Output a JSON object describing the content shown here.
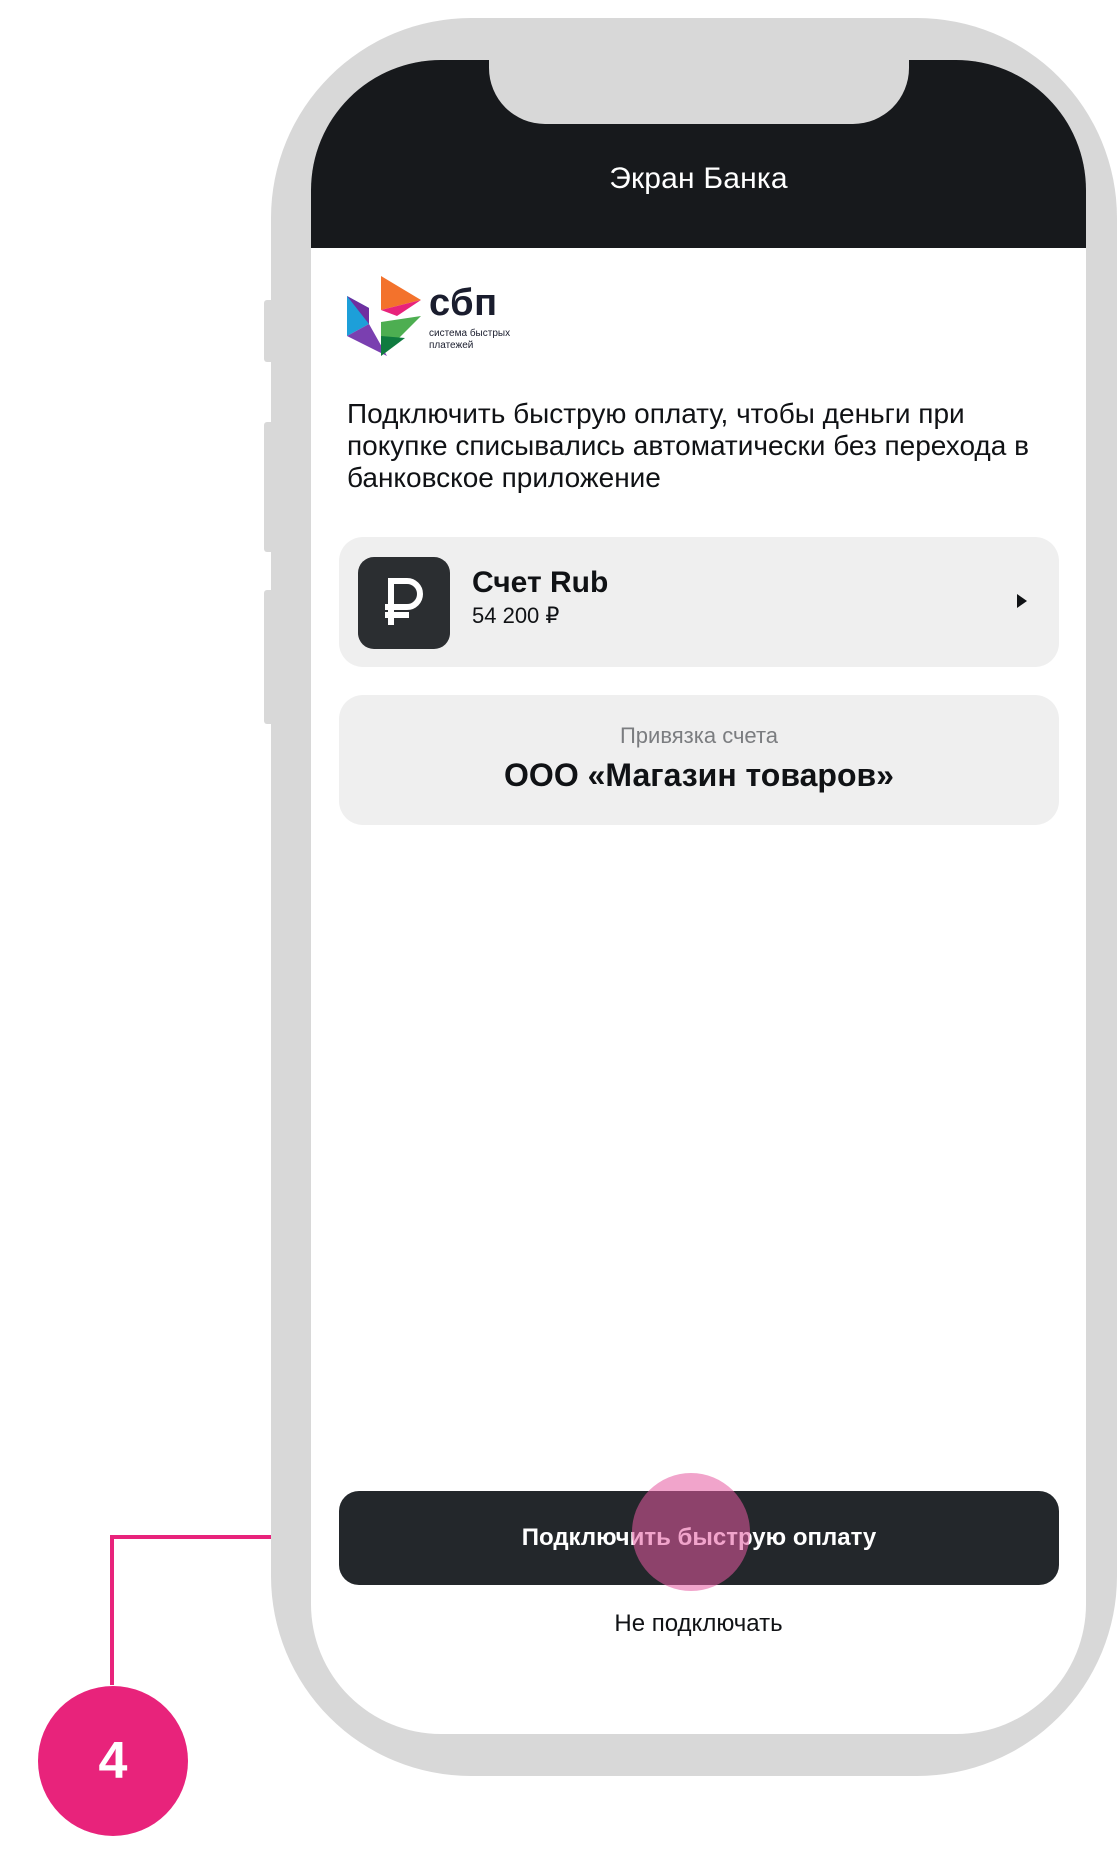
{
  "header": {
    "title": "Экран Банка"
  },
  "logo": {
    "wordmark": "сбп",
    "tagline": "система быстрых платежей",
    "colors": [
      "#1d9fd9",
      "#6f2fa0",
      "#f3722c",
      "#e8237b",
      "#4dae51",
      "#0f7b3f"
    ]
  },
  "description": "Подключить быструю оплату, чтобы деньги при покупке списывались автоматически без перехода в банковское приложение",
  "account": {
    "icon": "ruble-icon",
    "icon_glyph": "₽",
    "name": "Счет Rub",
    "balance": "54 200 ₽"
  },
  "merchant": {
    "label": "Привязка счета",
    "name": "ООО «Магазин товаров»"
  },
  "actions": {
    "connect_label": "Подключить быструю оплату",
    "decline_label": "Не подключать"
  },
  "callout": {
    "step": "4",
    "accent": "#e8237b"
  }
}
